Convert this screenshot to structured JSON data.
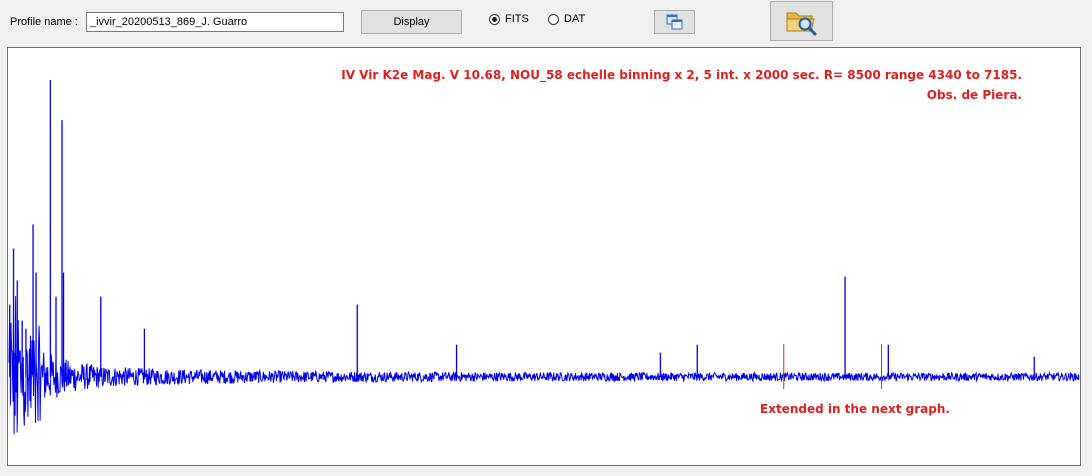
{
  "toolbar": {
    "profile_label": "Profile name :",
    "profile_value": "_ivvir_20200513_869_J. Guarro",
    "display_label": "Display",
    "fits_label": "FITS",
    "dat_label": "DAT",
    "fits_selected": true,
    "copy_icon": "copy-window-icon",
    "open_icon": "folder-search-icon"
  },
  "annotations": {
    "title_line1": "IV Vir  K2e Mag. V 10.68,  NOU_58 echelle binning x 2,   5 int. x  2000 sec.  R= 8500 range 4340 to 7185.",
    "title_line2": "Obs. de Piera.",
    "note": "Extended in the next graph."
  },
  "colors": {
    "spectrum": "#0000ee",
    "annotation": "#e02020",
    "marker": "#e02020"
  },
  "chart_data": {
    "type": "line",
    "title": "IV Vir  K2e Mag. V 10.68,  NOU_58 echelle binning x 2,   5 int. x  2000 sec.  R= 8500 range 4340 to 7185.",
    "xlabel": "",
    "ylabel": "",
    "grid": false,
    "legend": "none",
    "xlim": [
      4340,
      7185
    ],
    "ylim": [
      0,
      5
    ],
    "continuum": 1.0,
    "peaks": [
      {
        "x": 4342,
        "y": 1.9
      },
      {
        "x": 4352,
        "y": 2.6
      },
      {
        "x": 4362,
        "y": 2.2
      },
      {
        "x": 4375,
        "y": 1.7
      },
      {
        "x": 4385,
        "y": 1.6
      },
      {
        "x": 4404,
        "y": 2.9
      },
      {
        "x": 4412,
        "y": 2.3
      },
      {
        "x": 4450,
        "y": 4.7
      },
      {
        "x": 4465,
        "y": 2.0
      },
      {
        "x": 4481,
        "y": 4.2
      },
      {
        "x": 4485,
        "y": 2.3
      },
      {
        "x": 4584,
        "y": 2.0
      },
      {
        "x": 4700,
        "y": 1.6
      },
      {
        "x": 5266,
        "y": 1.9
      },
      {
        "x": 5530,
        "y": 1.4
      },
      {
        "x": 6072,
        "y": 1.3
      },
      {
        "x": 6170,
        "y": 1.4
      },
      {
        "x": 6563,
        "y": 2.25
      },
      {
        "x": 6678,
        "y": 1.4
      },
      {
        "x": 7066,
        "y": 1.25
      }
    ],
    "markers": [
      6400,
      6660
    ]
  }
}
